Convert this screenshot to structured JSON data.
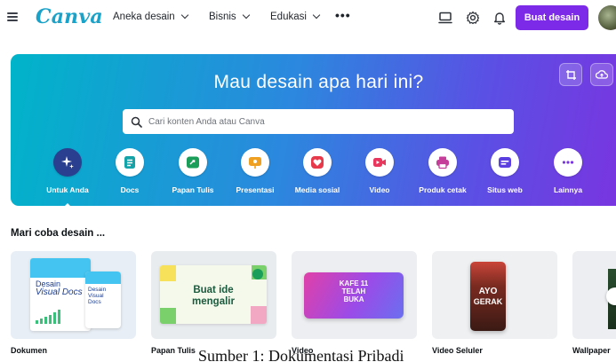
{
  "header": {
    "logo": "Canva",
    "nav": [
      {
        "label": "Aneka desain"
      },
      {
        "label": "Bisnis"
      },
      {
        "label": "Edukasi"
      }
    ],
    "more_label": "•••",
    "create_button": "Buat desain"
  },
  "hero": {
    "title": "Mau desain apa hari ini?",
    "search_placeholder": "Cari konten Anda atau Canva",
    "categories": [
      {
        "label": "Untuk Anda",
        "icon": "sparkle-icon",
        "color": "#243b8f",
        "active": true
      },
      {
        "label": "Docs",
        "icon": "doc-icon",
        "color": "#12a3a8"
      },
      {
        "label": "Papan Tulis",
        "icon": "whiteboard-icon",
        "color": "#1b9e5a"
      },
      {
        "label": "Presentasi",
        "icon": "presentation-icon",
        "color": "#f0a020"
      },
      {
        "label": "Media sosial",
        "icon": "heart-icon",
        "color": "#e8394a"
      },
      {
        "label": "Video",
        "icon": "video-icon",
        "color": "#e8365c"
      },
      {
        "label": "Produk cetak",
        "icon": "print-icon",
        "color": "#c43e9a"
      },
      {
        "label": "Situs web",
        "icon": "website-icon",
        "color": "#5b3fe0"
      },
      {
        "label": "Lainnya",
        "icon": "more-icon",
        "color": "#7a34e0"
      }
    ]
  },
  "section": {
    "title": "Mari coba desain ...",
    "cards": [
      {
        "label": "Dokumen",
        "thumb_text_1": "Desain",
        "thumb_text_2": "Visual Docs",
        "thumb_text_3": "Desain Visual Docs"
      },
      {
        "label": "Papan Tulis",
        "thumb_text_1": "Buat ide",
        "thumb_text_2": "mengalir"
      },
      {
        "label": "Video",
        "thumb_text_1": "KAFE 11",
        "thumb_text_2": "TELAH",
        "thumb_text_3": "BUKA"
      },
      {
        "label": "Video Seluler",
        "thumb_text_1": "AYO",
        "thumb_text_2": "GERAK"
      },
      {
        "label": "Wallpaper"
      }
    ]
  },
  "caption": "Sumber 1: Dokumentasi Pribadi",
  "colors": {
    "brand": "#1aa2c9",
    "accent": "#7d2ae8"
  }
}
